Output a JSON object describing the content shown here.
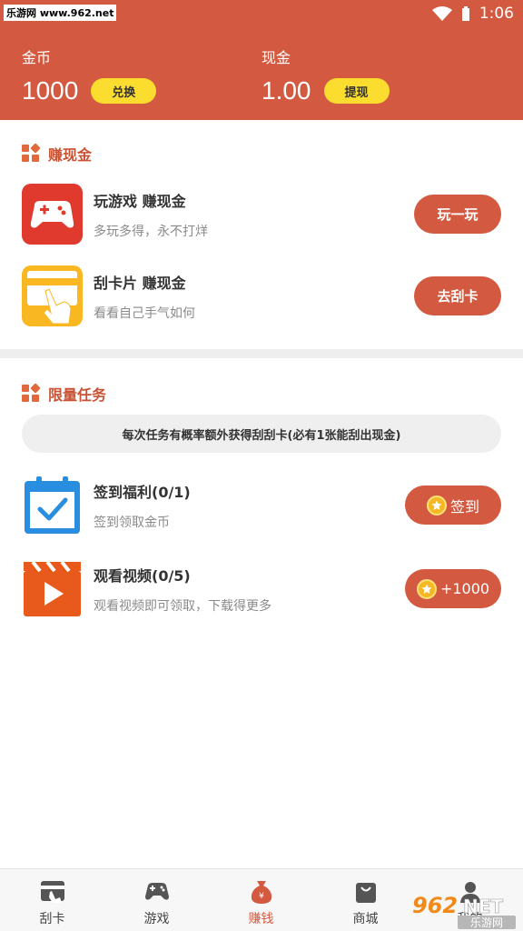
{
  "watermark": {
    "top": "乐游网 www.962.net",
    "bottom_digits": "962",
    "bottom_net": "NET",
    "bottom_cn": "乐游网"
  },
  "status_bar": {
    "time": "1:06"
  },
  "header": {
    "coins": {
      "label": "金币",
      "value": "1000",
      "button": "兑换"
    },
    "cash": {
      "label": "现金",
      "value": "1.00",
      "button": "提现"
    }
  },
  "earn_cash": {
    "title": "赚现金",
    "items": [
      {
        "title": "玩游戏 赚现金",
        "subtitle": "多玩多得，永不打烊",
        "button": "玩一玩"
      },
      {
        "title": "刮卡片 赚现金",
        "subtitle": "看看自己手气如何",
        "button": "去刮卡"
      }
    ]
  },
  "limited_tasks": {
    "title": "限量任务",
    "notice": "每次任务有概率额外获得刮刮卡(必有1张能刮出现金)",
    "items": [
      {
        "title": "签到福利(0/1)",
        "subtitle": "签到领取金币",
        "button": "签到"
      },
      {
        "title": "观看视频(0/5)",
        "subtitle": "观看视频即可领取，下载得更多",
        "button": "+1000"
      }
    ]
  },
  "tabbar": {
    "tabs": [
      {
        "label": "刮卡",
        "icon": "scratch-card-icon"
      },
      {
        "label": "游戏",
        "icon": "gamepad-icon"
      },
      {
        "label": "赚钱",
        "icon": "money-bag-icon",
        "active": true
      },
      {
        "label": "商城",
        "icon": "shopping-bag-icon"
      },
      {
        "label": "我的",
        "icon": "profile-icon"
      }
    ]
  },
  "colors": {
    "primary": "#d35a40",
    "accent_yellow": "#fadd2e",
    "game_red": "#e03a2e",
    "card_yellow": "#f9b722",
    "calendar_blue": "#2a8ee0",
    "video_orange": "#e85a1c"
  }
}
